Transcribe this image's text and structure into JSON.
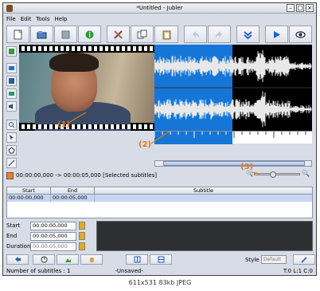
{
  "window": {
    "title": "*Untitled - Jubler",
    "min": "–",
    "max": "□",
    "close": "×"
  },
  "menu": [
    "File",
    "Edit",
    "Tools",
    "Help"
  ],
  "toolbar_icons": [
    "new-file-icon",
    "open-folder-icon",
    "save-icon",
    "info-icon",
    "tools-icon",
    "copy-icon",
    "paste-icon",
    "undo-icon",
    "redo-icon",
    "jump-icon",
    "play-icon",
    "preview-icon"
  ],
  "info_line": "00:00:00,000 -> 00:00:05,000 [Selected subtitles]",
  "table": {
    "headers": [
      "Start",
      "End",
      "Subtitle"
    ],
    "rows": [
      {
        "start": "00:00:00,000",
        "end": "00:00:05,000",
        "subtitle": ""
      }
    ]
  },
  "editor": {
    "start_label": "Start",
    "start_value": "00:00:00,000",
    "end_label": "End",
    "end_value": "00:00:05,000",
    "duration_label": "Duration",
    "duration_value": "00:00:05,000"
  },
  "style": {
    "label": "Style",
    "value": "Default"
  },
  "status": {
    "count": "Number of subtitles : 1",
    "saved": "-Unsaved-",
    "position": "T:0 L:1 C:0"
  },
  "annotations": [
    "(1)",
    "(2)",
    "(3)"
  ],
  "caption": "611x531 83kb JPEG",
  "colors": {
    "selection": "#1676d8",
    "annotation": "#d97a16",
    "row_highlight": "#c6d6f2"
  }
}
